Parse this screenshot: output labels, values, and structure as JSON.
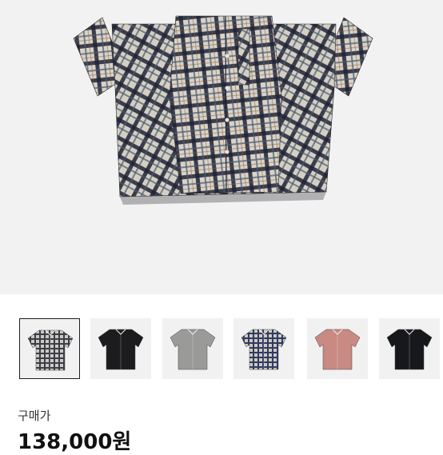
{
  "product": {
    "main_image": "plaid-short-sleeve-shirt",
    "colors": {
      "plaid_base": "#d9d3c7",
      "plaid_dark": "#1f2336",
      "plaid_accent": "#4a5a6e",
      "background": "#f2f2f2"
    },
    "thumbnails": [
      {
        "name": "plaid-shirt",
        "color": "#3a3d4a",
        "pattern": "plaid",
        "selected": true
      },
      {
        "name": "black-shirt",
        "color": "#1c1c1e",
        "pattern": "solid",
        "selected": false
      },
      {
        "name": "grey-shirt",
        "color": "#9a9b98",
        "pattern": "solid",
        "selected": false
      },
      {
        "name": "navy-plaid-shirt",
        "color": "#2f3a63",
        "pattern": "plaid",
        "selected": false
      },
      {
        "name": "pink-zip-shirt",
        "color": "#c98a83",
        "pattern": "solid",
        "selected": false
      },
      {
        "name": "black-zip-shirt",
        "color": "#17181b",
        "pattern": "solid",
        "selected": false
      }
    ]
  },
  "price_section": {
    "label": "구매가",
    "price": "138,000원"
  }
}
